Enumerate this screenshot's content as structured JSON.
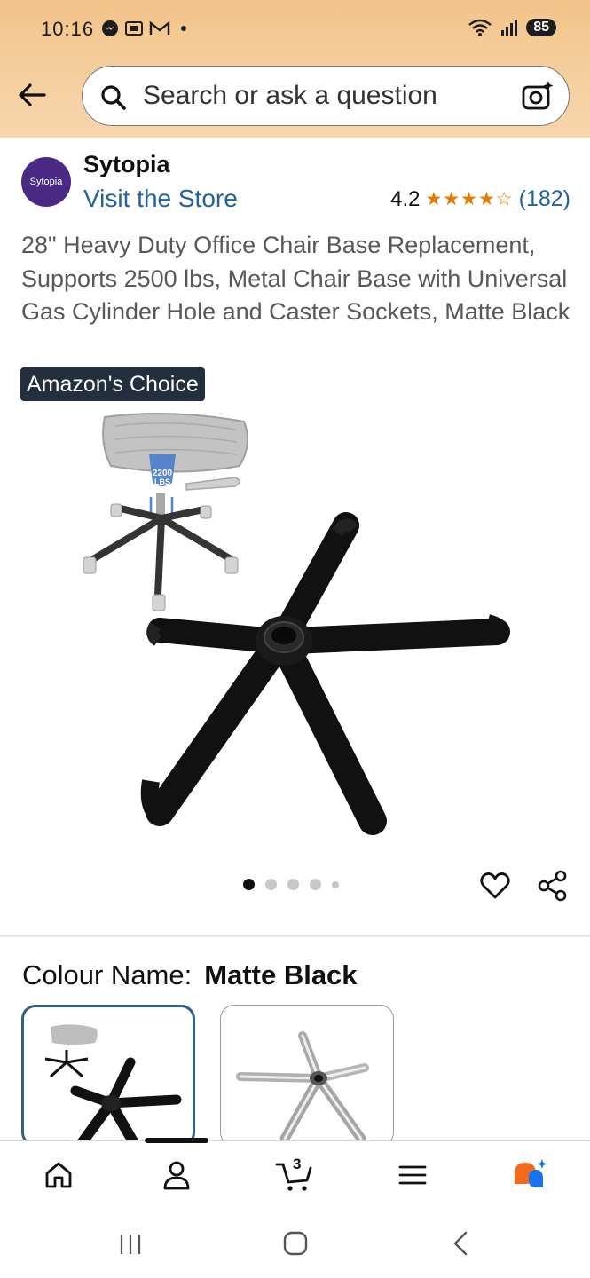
{
  "status_bar": {
    "time": "10:16",
    "battery": "85"
  },
  "search": {
    "placeholder": "Search or ask a question"
  },
  "product": {
    "brand_name": "Sytopia",
    "brand_logo_text": "Sytopia",
    "visit_store": "Visit the Store",
    "rating": "4.2",
    "stars": "★★★★☆",
    "rating_count": "(182)",
    "title": "28\" Heavy Duty Office Chair Base Replacement, Supports 2500 lbs, Metal Chair Base with Universal Gas Cylinder Hole and Caster Sockets, Matte Black",
    "badge": "Amazon's Choice",
    "inset_weight_label_1": "2200",
    "inset_weight_label_2": "LBS",
    "image_count": 5,
    "active_image": 1
  },
  "variation": {
    "label": "Colour Name:",
    "value": "Matte Black",
    "options": [
      {
        "name": "Matte Black",
        "selected": true,
        "color": "#111111"
      },
      {
        "name": "Chrome",
        "selected": false,
        "color": "#c8c8c8"
      }
    ]
  },
  "bottom_nav": {
    "items": [
      "home-icon",
      "account-icon",
      "cart-icon",
      "menu-icon",
      "rufus-icon"
    ],
    "cart_count": "3",
    "active_index": 1
  },
  "colors": {
    "header_bg": "#f3c892",
    "link": "#2162a1",
    "star": "#e67a00",
    "badge_bg": "#232f3e",
    "selected_swatch_border": "#2f5f8a"
  }
}
